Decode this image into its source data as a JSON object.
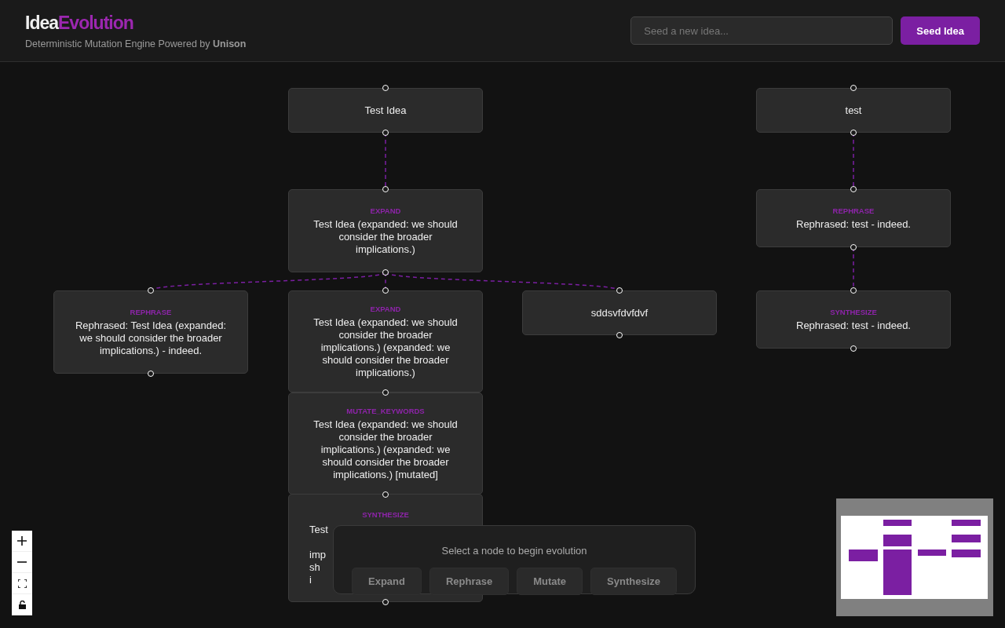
{
  "header": {
    "title_first": "Idea",
    "title_second": "Evolution",
    "subtitle": "Deterministic Mutation Engine Powered by **Unison**"
  },
  "seed_field": {
    "placeholder": "Seed a new idea..."
  },
  "seed_button": "Seed Idea",
  "nodes": [
    {
      "kind": "seed",
      "text": "Test Idea"
    },
    {
      "kind": "seed",
      "text": "test"
    },
    {
      "kind": "mutation",
      "operation": "EXPAND",
      "text": "Test Idea (expanded: we should consider the broader implications.)"
    },
    {
      "kind": "mutation",
      "operation": "REPHRASE",
      "text": "Rephrased: test - indeed."
    },
    {
      "kind": "mutation",
      "operation": "REPHRASE",
      "text": "Rephrased: Test Idea (expanded: we should consider the broader implications.) - indeed."
    },
    {
      "kind": "mutation",
      "operation": "EXPAND",
      "text": "Test Idea (expanded: we should consider the broader implications.) (expanded: we should consider the broader implications.)"
    },
    {
      "kind": "seed",
      "text": "sddsvfdvfdvf"
    },
    {
      "kind": "mutation",
      "operation": "SYNTHESIZE",
      "text": "Rephrased: test - indeed."
    },
    {
      "kind": "mutation",
      "operation": "MUTATE_KEYWORDS",
      "text": "Test Idea (expanded: we should consider the broader implications.) (expanded: we should consider the broader implications.) [mutated]"
    },
    {
      "kind": "covered",
      "operation": "SYNTHESIZE",
      "fragments": [
        "Test",
        "imp",
        "sh",
        "i"
      ]
    }
  ],
  "action_panel": {
    "prompt": "Select a node to begin evolution",
    "buttons": [
      {
        "label": "Expand",
        "disabled": true
      },
      {
        "label": "Rephrase",
        "disabled": true
      },
      {
        "label": "Mutate",
        "disabled": true
      },
      {
        "label": "Synthesize",
        "disabled": true
      }
    ]
  }
}
